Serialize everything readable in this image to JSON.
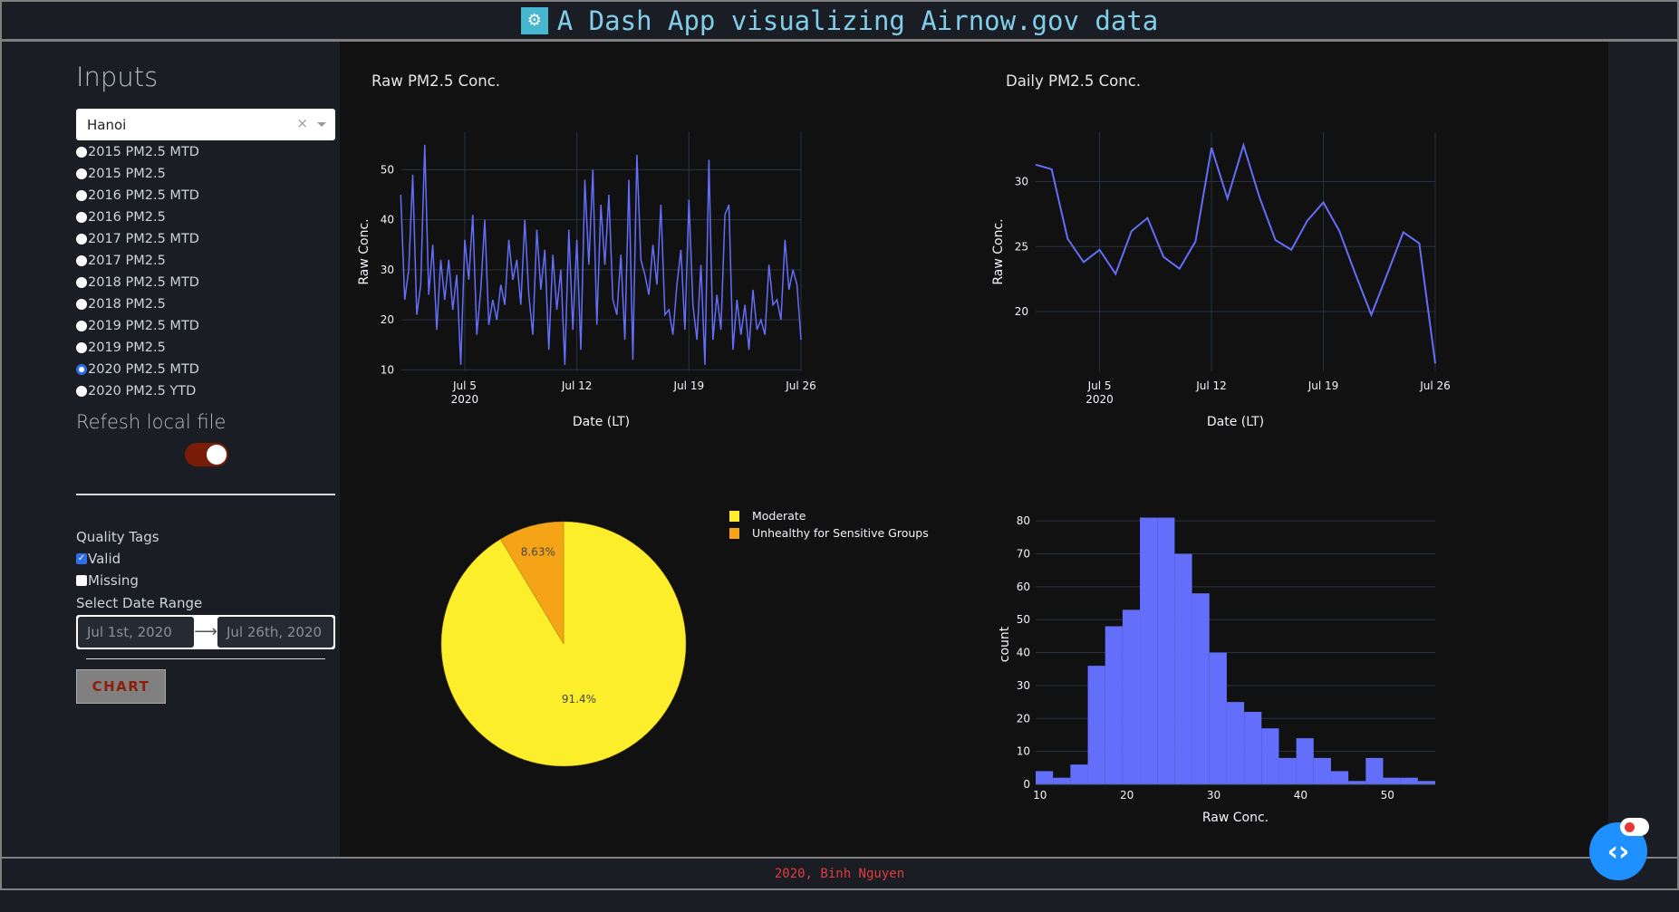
{
  "header": {
    "title": "A Dash App visualizing Airnow.gov data",
    "logo_icon": "chart-logo-icon"
  },
  "sidebar": {
    "heading": "Inputs",
    "city_dropdown": {
      "value": "Hanoi",
      "clear": "×"
    },
    "datasets": [
      {
        "label": "2015 PM2.5 MTD",
        "selected": false
      },
      {
        "label": "2015 PM2.5",
        "selected": false
      },
      {
        "label": "2016 PM2.5 MTD",
        "selected": false
      },
      {
        "label": "2016 PM2.5",
        "selected": false
      },
      {
        "label": "2017 PM2.5 MTD",
        "selected": false
      },
      {
        "label": "2017 PM2.5",
        "selected": false
      },
      {
        "label": "2018 PM2.5 MTD",
        "selected": false
      },
      {
        "label": "2018 PM2.5",
        "selected": false
      },
      {
        "label": "2019 PM2.5 MTD",
        "selected": false
      },
      {
        "label": "2019 PM2.5",
        "selected": false
      },
      {
        "label": "2020 PM2.5 MTD",
        "selected": true
      },
      {
        "label": "2020 PM2.5 YTD",
        "selected": false
      }
    ],
    "refresh_heading": "Refesh local file",
    "refresh_toggle_on": true,
    "quality_tags_label": "Quality Tags",
    "quality_tags": [
      {
        "label": "Valid",
        "checked": true
      },
      {
        "label": "Missing",
        "checked": false
      }
    ],
    "date_range_label": "Select Date Range",
    "start_date": "Jul 1st, 2020",
    "end_date": "Jul 26th, 2020",
    "chart_button": "CHART"
  },
  "footer": {
    "text": "2020, Binh Nguyen"
  },
  "colors": {
    "line": "#636efa",
    "moderate": "#fcee2b",
    "usg": "#f4a416",
    "toggle": "#7a1d08",
    "accent": "#1e90ff"
  },
  "chart_data": [
    {
      "type": "line",
      "title": "Raw PM2.5 Conc.",
      "xlabel": "Date (LT)",
      "ylabel": "Raw Conc.",
      "xticks": [
        "Jul 5",
        "Jul 12",
        "Jul 19",
        "Jul 26"
      ],
      "xtick_year": "2020",
      "yticks": [
        10,
        20,
        30,
        40,
        50
      ],
      "ylim": [
        9.7,
        57.5
      ],
      "xlim": [
        "2020-07-01 01:00",
        "2020-07-26 00:00"
      ],
      "grid": true,
      "points": [
        [
          "2020-07-01 00:00",
          45
        ],
        [
          "2020-07-01 06:00",
          24
        ],
        [
          "2020-07-01 12:00",
          30
        ],
        [
          "2020-07-01 18:00",
          49
        ],
        [
          "2020-07-02 00:00",
          21
        ],
        [
          "2020-07-02 06:00",
          27
        ],
        [
          "2020-07-02 12:00",
          55
        ],
        [
          "2020-07-02 18:00",
          25
        ],
        [
          "2020-07-03 00:00",
          35
        ],
        [
          "2020-07-03 06:00",
          18
        ],
        [
          "2020-07-03 12:00",
          32
        ],
        [
          "2020-07-03 18:00",
          24
        ],
        [
          "2020-07-04 00:00",
          32
        ],
        [
          "2020-07-04 06:00",
          22
        ],
        [
          "2020-07-04 12:00",
          29
        ],
        [
          "2020-07-04 18:00",
          11
        ],
        [
          "2020-07-05 00:00",
          36
        ],
        [
          "2020-07-05 06:00",
          28
        ],
        [
          "2020-07-05 12:00",
          41
        ],
        [
          "2020-07-05 18:00",
          17
        ],
        [
          "2020-07-06 00:00",
          26
        ],
        [
          "2020-07-06 06:00",
          40
        ],
        [
          "2020-07-06 12:00",
          19
        ],
        [
          "2020-07-06 18:00",
          24
        ],
        [
          "2020-07-07 00:00",
          20
        ],
        [
          "2020-07-07 06:00",
          27
        ],
        [
          "2020-07-07 12:00",
          23
        ],
        [
          "2020-07-07 18:00",
          36
        ],
        [
          "2020-07-08 00:00",
          28
        ],
        [
          "2020-07-08 06:00",
          32
        ],
        [
          "2020-07-08 12:00",
          23
        ],
        [
          "2020-07-08 18:00",
          40
        ],
        [
          "2020-07-09 00:00",
          25
        ],
        [
          "2020-07-09 06:00",
          17
        ],
        [
          "2020-07-09 12:00",
          38
        ],
        [
          "2020-07-09 18:00",
          26
        ],
        [
          "2020-07-10 00:00",
          34
        ],
        [
          "2020-07-10 06:00",
          14
        ],
        [
          "2020-07-10 12:00",
          33
        ],
        [
          "2020-07-10 18:00",
          22
        ],
        [
          "2020-07-11 00:00",
          30
        ],
        [
          "2020-07-11 06:00",
          11
        ],
        [
          "2020-07-11 12:00",
          38
        ],
        [
          "2020-07-11 18:00",
          18
        ],
        [
          "2020-07-12 00:00",
          36
        ],
        [
          "2020-07-12 06:00",
          14
        ],
        [
          "2020-07-12 12:00",
          48
        ],
        [
          "2020-07-12 18:00",
          31
        ],
        [
          "2020-07-13 00:00",
          50
        ],
        [
          "2020-07-13 06:00",
          19
        ],
        [
          "2020-07-13 12:00",
          43
        ],
        [
          "2020-07-13 18:00",
          31
        ],
        [
          "2020-07-14 00:00",
          45
        ],
        [
          "2020-07-14 06:00",
          24
        ],
        [
          "2020-07-14 12:00",
          21
        ],
        [
          "2020-07-14 18:00",
          33
        ],
        [
          "2020-07-15 00:00",
          16
        ],
        [
          "2020-07-15 06:00",
          48
        ],
        [
          "2020-07-15 12:00",
          12
        ],
        [
          "2020-07-15 18:00",
          53
        ],
        [
          "2020-07-16 00:00",
          32
        ],
        [
          "2020-07-16 06:00",
          29
        ],
        [
          "2020-07-16 12:00",
          25
        ],
        [
          "2020-07-16 18:00",
          35
        ],
        [
          "2020-07-17 00:00",
          27
        ],
        [
          "2020-07-17 06:00",
          43
        ],
        [
          "2020-07-17 12:00",
          21
        ],
        [
          "2020-07-17 18:00",
          22
        ],
        [
          "2020-07-18 00:00",
          17
        ],
        [
          "2020-07-18 06:00",
          27
        ],
        [
          "2020-07-18 12:00",
          34
        ],
        [
          "2020-07-18 18:00",
          18
        ],
        [
          "2020-07-19 00:00",
          44
        ],
        [
          "2020-07-19 06:00",
          23
        ],
        [
          "2020-07-19 12:00",
          16
        ],
        [
          "2020-07-19 18:00",
          31
        ],
        [
          "2020-07-20 00:00",
          11
        ],
        [
          "2020-07-20 06:00",
          52
        ],
        [
          "2020-07-20 12:00",
          16
        ],
        [
          "2020-07-20 18:00",
          25
        ],
        [
          "2020-07-21 00:00",
          18
        ],
        [
          "2020-07-21 06:00",
          41
        ],
        [
          "2020-07-21 12:00",
          43
        ],
        [
          "2020-07-21 18:00",
          14
        ],
        [
          "2020-07-22 00:00",
          24
        ],
        [
          "2020-07-22 06:00",
          17
        ],
        [
          "2020-07-22 12:00",
          23
        ],
        [
          "2020-07-22 18:00",
          14
        ],
        [
          "2020-07-23 00:00",
          26
        ],
        [
          "2020-07-23 06:00",
          18
        ],
        [
          "2020-07-23 12:00",
          20
        ],
        [
          "2020-07-23 18:00",
          17
        ],
        [
          "2020-07-24 00:00",
          31
        ],
        [
          "2020-07-24 06:00",
          23
        ],
        [
          "2020-07-24 12:00",
          24
        ],
        [
          "2020-07-24 18:00",
          20
        ],
        [
          "2020-07-25 00:00",
          36
        ],
        [
          "2020-07-25 06:00",
          26
        ],
        [
          "2020-07-25 12:00",
          30
        ],
        [
          "2020-07-25 18:00",
          27
        ],
        [
          "2020-07-26 00:00",
          16
        ]
      ]
    },
    {
      "type": "line",
      "title": "Daily PM2.5 Conc.",
      "xlabel": "Date (LT)",
      "ylabel": "Raw Conc.",
      "xticks": [
        "Jul 5",
        "Jul 12",
        "Jul 19",
        "Jul 26"
      ],
      "xtick_year": "2020",
      "yticks": [
        20,
        25,
        30
      ],
      "ylim": [
        15.4,
        33.8
      ],
      "grid": true,
      "x": [
        "2020-07-01",
        "2020-07-02",
        "2020-07-03",
        "2020-07-04",
        "2020-07-05",
        "2020-07-06",
        "2020-07-07",
        "2020-07-08",
        "2020-07-09",
        "2020-07-10",
        "2020-07-11",
        "2020-07-12",
        "2020-07-13",
        "2020-07-14",
        "2020-07-15",
        "2020-07-16",
        "2020-07-17",
        "2020-07-18",
        "2020-07-19",
        "2020-07-20",
        "2020-07-21",
        "2020-07-22",
        "2020-07-23",
        "2020-07-24",
        "2020-07-25",
        "2020-07-26"
      ],
      "y": [
        31.3,
        30.95,
        25.6,
        23.8,
        24.75,
        22.9,
        26.2,
        27.2,
        24.2,
        23.3,
        25.4,
        32.6,
        28.7,
        32.8,
        28.8,
        25.5,
        24.75,
        27.0,
        28.4,
        26.2,
        22.9,
        19.75,
        22.9,
        26.1,
        25.25,
        16.0
      ]
    },
    {
      "type": "pie",
      "labels": [
        "Moderate",
        "Unhealthy for Sensitive Groups"
      ],
      "values": [
        91.37,
        8.63
      ],
      "text_labels": [
        "91.4%",
        "8.63%"
      ],
      "colors": [
        "#fcee2b",
        "#f4a416"
      ],
      "legend": "top-right"
    },
    {
      "type": "bar",
      "subtype": "histogram",
      "xlabel": "Raw Conc.",
      "ylabel": "count",
      "bin_start": 9.5,
      "bin_size": 2,
      "counts": [
        4,
        2,
        6,
        36,
        48,
        53,
        81,
        81,
        70,
        58,
        40,
        25,
        22,
        17,
        8,
        14,
        8,
        4,
        1,
        8,
        2,
        2,
        1
      ],
      "xticks": [
        10,
        20,
        30,
        40,
        50
      ],
      "yticks": [
        0,
        10,
        20,
        30,
        40,
        50,
        60,
        70,
        80
      ],
      "xlim": [
        9.5,
        55.5
      ],
      "ylim": [
        0,
        85
      ],
      "grid": true
    }
  ]
}
